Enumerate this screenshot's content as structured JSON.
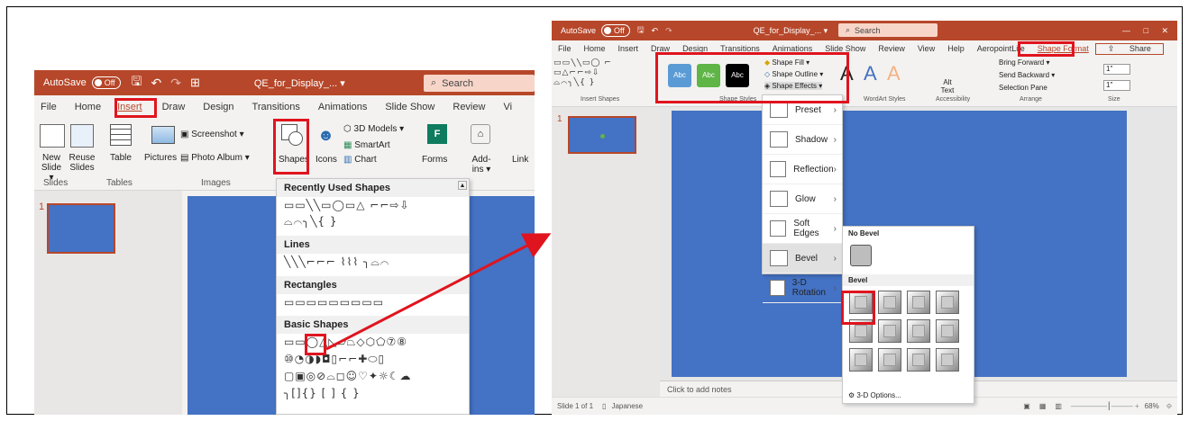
{
  "left": {
    "autosave": "AutoSave",
    "toggle": "Off",
    "filename": "QE_for_Display_... ▾",
    "search": "Search",
    "tabs": [
      "File",
      "Home",
      "Insert",
      "Draw",
      "Design",
      "Transitions",
      "Animations",
      "Slide Show",
      "Review",
      "Vi"
    ],
    "ribbon": {
      "new_slide": "New Slide ▾",
      "reuse_slides": "Reuse Slides",
      "table": "Table",
      "pictures": "Pictures",
      "screenshot": "Screenshot ▾",
      "photo_album": "Photo Album ▾",
      "shapes": "Shapes",
      "icons": "Icons",
      "models": "3D Models ▾",
      "smartart": "SmartArt",
      "chart": "Chart",
      "forms": "Forms",
      "addins": "Add-ins ▾",
      "link": "Link",
      "grp_slides": "Slides",
      "grp_tables": "Tables",
      "grp_images": "Images"
    },
    "slide_num": "1",
    "shapes_menu": {
      "recent": "Recently Used Shapes",
      "recent_glyphs1": "▭▭╲╲▭◯▭△ ⌐⌐⇨⇩",
      "recent_glyphs2": "⌓⌒╮╲{ }",
      "lines": "Lines",
      "lines_glyphs": "╲╲╲⌐⌐⌐ ⌇⌇⌇ ╮⌓⌒",
      "rects": "Rectangles",
      "rects_glyphs": "▭▭▭▭▭▭▭▭▭",
      "basic": "Basic Shapes",
      "basic_glyphs1": "▭▭◯△◺▱⏢◇⬡⬠⑦⑧",
      "basic_glyphs2": "⑩◔◑◗◘▯⌐⌐✚⬭▯",
      "basic_glyphs3": "▢▣◎⊘⌓◻☺♡✦☼☾☁",
      "basic_glyphs4": "╮[]{} [ ] { }"
    }
  },
  "right": {
    "autosave": "AutoSave",
    "toggle": "Off",
    "filename": "QE_for_Display_... ▾",
    "search": "Search",
    "tabs": [
      "File",
      "Home",
      "Insert",
      "Draw",
      "Design",
      "Transitions",
      "Animations",
      "Slide Show",
      "Review",
      "View",
      "Help",
      "AeropointLite",
      "Shape Format"
    ],
    "share": "Share",
    "style_labels": [
      "Abc",
      "Abc",
      "Abc"
    ],
    "shape_fill": "Shape Fill ▾",
    "shape_outline": "Shape Outline ▾",
    "shape_effects": "Shape Effects ▾",
    "grp_insert": "Insert Shapes",
    "grp_styles": "Shape Styles",
    "grp_wordart": "WordArt Styles",
    "grp_access": "Accessibility",
    "grp_arrange": "Arrange",
    "grp_size": "Size",
    "alt_text": "Alt Text",
    "bring_forward": "Bring Forward ▾",
    "send_backward": "Send Backward ▾",
    "selection_pane": "Selection Pane",
    "size_h": "1\"",
    "size_w": "1\"",
    "slide_num": "1",
    "effects": [
      "Preset",
      "Shadow",
      "Reflection",
      "Glow",
      "Soft Edges",
      "Bevel",
      "3-D Rotation"
    ],
    "bevel_panel": {
      "no_bevel": "No Bevel",
      "bevel": "Bevel",
      "options": "3-D Options..."
    },
    "notes": "Click to add notes",
    "status_left": "Slide 1 of 1",
    "status_lang": "Japanese",
    "zoom": "68%",
    "colors": {
      "green": "#5fb546",
      "blue": "#5b9bd5"
    }
  }
}
